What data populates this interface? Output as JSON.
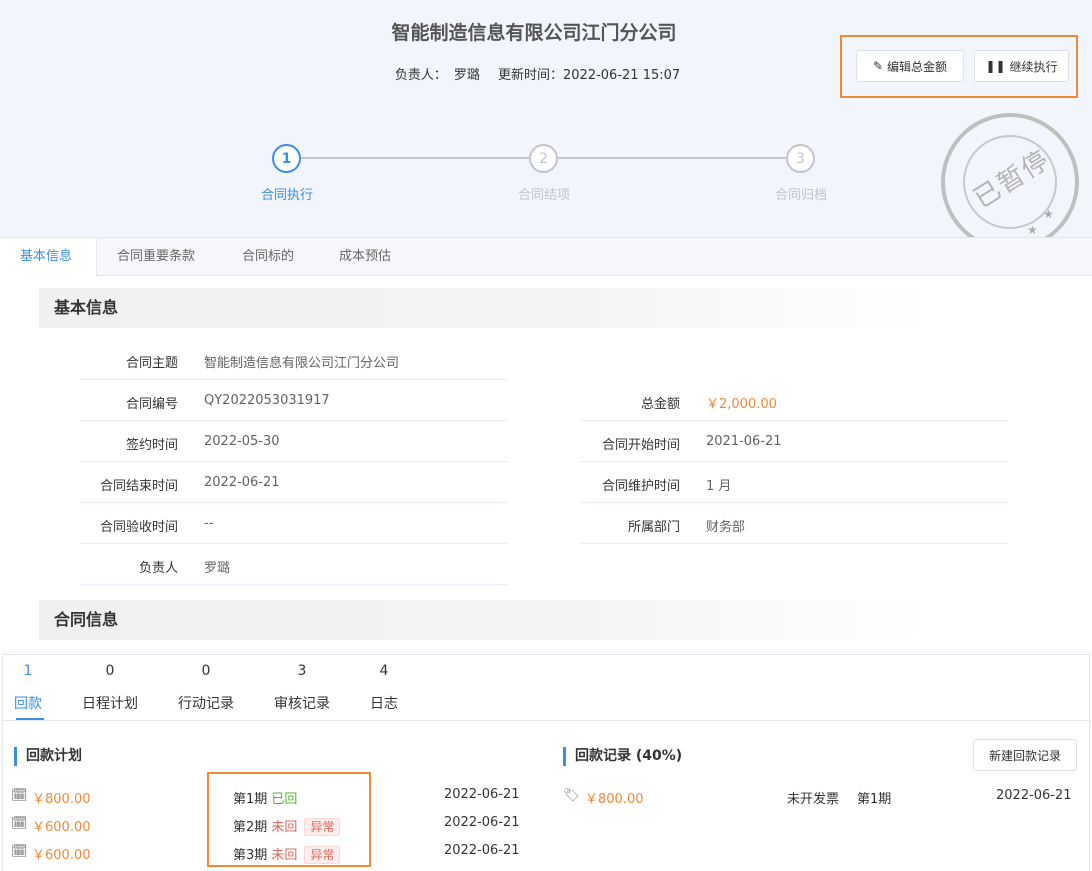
{
  "header": {
    "title": "智能制造信息有限公司江门分公司",
    "owner_label": "负责人：",
    "owner": "罗璐",
    "updated_label": "更新时间：",
    "updated": "2022-06-21 15:07"
  },
  "actions": {
    "edit_total": "编辑总金额",
    "continue": "继续执行"
  },
  "steps": [
    {
      "num": "1",
      "label": "合同执行",
      "active": true
    },
    {
      "num": "2",
      "label": "合同结项",
      "active": false
    },
    {
      "num": "3",
      "label": "合同归档",
      "active": false
    }
  ],
  "stamp": {
    "text": "已暂停",
    "color": "#bfbfbf"
  },
  "tabs": [
    "基本信息",
    "合同重要条款",
    "合同标的",
    "成本预估"
  ],
  "basic": {
    "section_title": "基本信息",
    "left": [
      {
        "label": "合同主题",
        "value": "智能制造信息有限公司江门分公司"
      },
      {
        "label": "合同编号",
        "value": "QY2022053031917"
      },
      {
        "label": "签约时间",
        "value": "2022-05-30"
      },
      {
        "label": "合同结束时间",
        "value": "2022-06-21"
      },
      {
        "label": "合同验收时间",
        "value": "--"
      },
      {
        "label": "负责人",
        "value": "罗璐"
      }
    ],
    "right": [
      {
        "label": "总金额",
        "value": "￥2,000.00"
      },
      {
        "label": "合同开始时间",
        "value": "2021-06-21"
      },
      {
        "label": "合同维护时间",
        "value": "1 月"
      },
      {
        "label": "所属部门",
        "value": "财务部"
      }
    ]
  },
  "contract_section_title": "合同信息",
  "panel": {
    "tabs": [
      {
        "count": "1",
        "label": "回款"
      },
      {
        "count": "0",
        "label": "日程计划"
      },
      {
        "count": "0",
        "label": "行动记录"
      },
      {
        "count": "3",
        "label": "审核记录"
      },
      {
        "count": "4",
        "label": "日志"
      }
    ],
    "plan_title": "回款计划",
    "record_title": "回款记录 (40%)",
    "new_record_button": "新建回款记录",
    "plans": [
      {
        "amount": "￥800.00",
        "period": "第1期",
        "status": "已回",
        "badge": "",
        "date": "2022-06-21"
      },
      {
        "amount": "￥600.00",
        "period": "第2期",
        "status": "未回",
        "badge": "异常",
        "date": "2022-06-21"
      },
      {
        "amount": "￥600.00",
        "period": "第3期",
        "status": "未回",
        "badge": "异常",
        "date": "2022-06-21"
      }
    ],
    "record": {
      "amount": "￥800.00",
      "invoice": "未开发票",
      "period": "第1期",
      "date": "2022-06-21"
    }
  },
  "colors": {
    "accent": "#3a8ee6",
    "amount": "#f0883a",
    "highlight": "#f0883a",
    "ok": "#52b435",
    "bad": "#e0645a"
  }
}
